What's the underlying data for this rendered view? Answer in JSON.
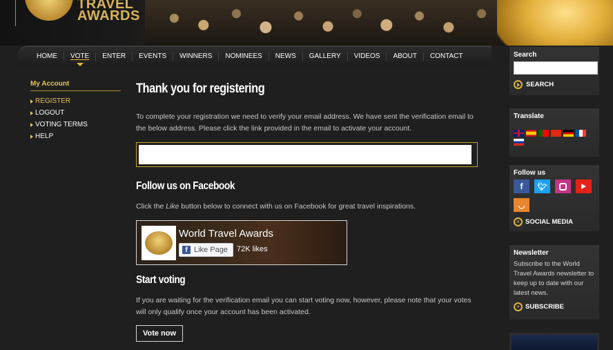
{
  "header": {
    "logo_text": "TRAVEL AWARDS"
  },
  "nav": {
    "items": [
      "HOME",
      "VOTE",
      "ENTER",
      "EVENTS",
      "WINNERS",
      "NOMINEES",
      "NEWS",
      "GALLERY",
      "VIDEOS",
      "ABOUT",
      "CONTACT"
    ],
    "active": "VOTE"
  },
  "account": {
    "title": "My Account",
    "items": [
      "REGISTER",
      "LOGOUT",
      "VOTING TERMS",
      "HELP"
    ]
  },
  "main": {
    "title": "Thank you for registering",
    "intro": "To complete your registration we need to verify your email address. We have sent the verification email to the below address. Please click the link provided in the email to activate your account.",
    "email_value": "",
    "facebook_heading": "Follow us on Facebook",
    "facebook_text_before": "Click the ",
    "facebook_text_em": "Like",
    "facebook_text_after": " button below to connect with us on Facebook for great travel inspirations.",
    "fb_page_name": "World Travel Awards",
    "fb_like_label": "Like Page",
    "fb_likes": "72K likes",
    "vote_heading": "Start voting",
    "vote_text": "If you are waiting for the verification email you can start voting now, however, please note that your votes will only qualify once your account has been activated.",
    "vote_button": "Vote now"
  },
  "sidebar": {
    "search_title": "Search",
    "search_button": "SEARCH",
    "translate_title": "Translate",
    "follow_title": "Follow us",
    "social_media_link": "SOCIAL MEDIA",
    "newsletter_title": "Newsletter",
    "newsletter_text": "Subscribe to the World Travel Awards newsletter to keep up to date with our latest news.",
    "subscribe_link": "SUBSCRIBE"
  },
  "colors": {
    "accent_gold": "#e7c25a",
    "facebook": "#3b5998",
    "twitter": "#1da1f2",
    "instagram": "#c13584",
    "youtube": "#e62117",
    "rss": "#e8852f"
  }
}
